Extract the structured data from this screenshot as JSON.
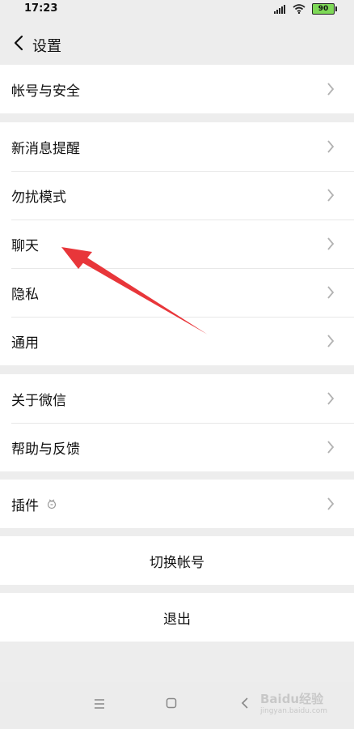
{
  "status_bar": {
    "time": "17:23",
    "battery": "90"
  },
  "header": {
    "title": "设置"
  },
  "groups": [
    {
      "items": [
        {
          "label": "帐号与安全"
        }
      ]
    },
    {
      "items": [
        {
          "label": "新消息提醒"
        },
        {
          "label": "勿扰模式"
        },
        {
          "label": "聊天"
        },
        {
          "label": "隐私"
        },
        {
          "label": "通用"
        }
      ]
    },
    {
      "items": [
        {
          "label": "关于微信"
        },
        {
          "label": "帮助与反馈"
        }
      ]
    },
    {
      "items": [
        {
          "label": "插件"
        }
      ]
    }
  ],
  "actions": {
    "switch_account": "切换帐号",
    "logout": "退出"
  },
  "watermark": {
    "brand": "Baidu经验",
    "url": "jingyan.baidu.com"
  },
  "colors": {
    "background": "#ededed",
    "annotation_arrow": "#e8363a",
    "battery": "#7ed957"
  }
}
